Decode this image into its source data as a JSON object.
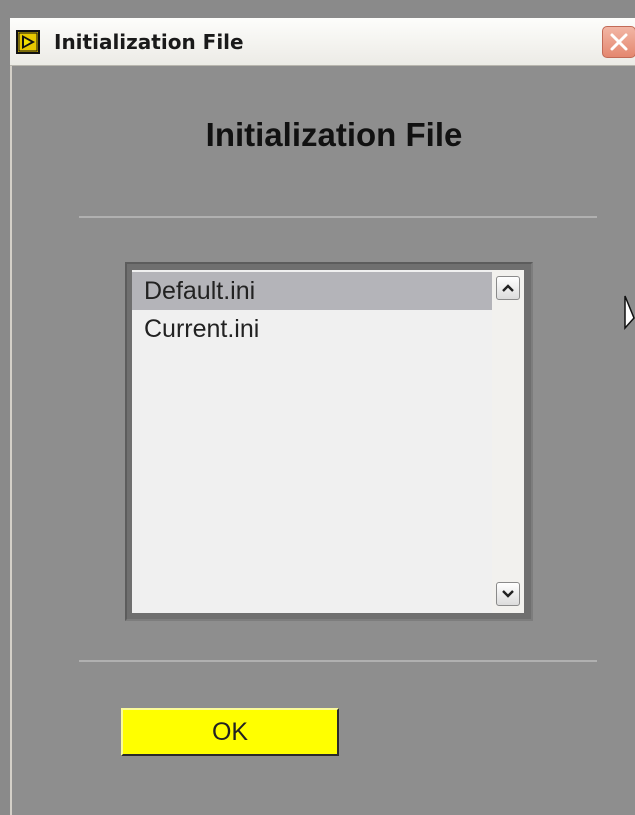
{
  "window": {
    "title": "Initialization File",
    "close_icon": "close-icon",
    "app_icon": "labview-run-icon"
  },
  "dialog": {
    "heading": "Initialization File",
    "file_list": {
      "items": [
        {
          "label": "Default.ini",
          "selected": true
        },
        {
          "label": "Current.ini",
          "selected": false
        }
      ]
    },
    "ok_label": "OK"
  },
  "colors": {
    "panel": "#8e8e8e",
    "list_background": "#f0f0f0",
    "selection": "#b4b4b9",
    "ok_button": "#ffff00",
    "close_button": "#e4876f"
  }
}
